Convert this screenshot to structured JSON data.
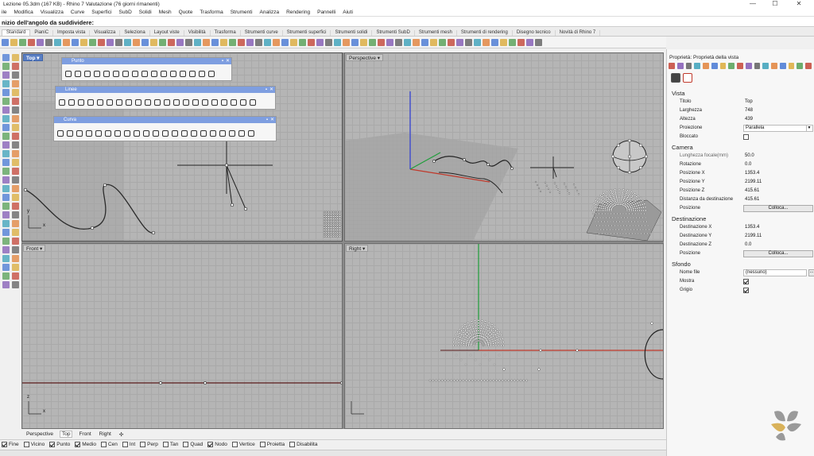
{
  "window": {
    "title": "Lezione 05.3dm (167 KB) - Rhino 7 Valutazione (76 giorni rimanenti)",
    "min": "—",
    "max": "☐",
    "close": "✕"
  },
  "menu": [
    "ile",
    "Modifica",
    "Visualizza",
    "Curve",
    "Superfici",
    "SubD",
    "Solidi",
    "Mesh",
    "Quote",
    "Trasforma",
    "Strumenti",
    "Analizza",
    "Rendering",
    "Pannelli",
    "Aiuti"
  ],
  "command_prompt": "nizio dell'angolo da suddividere:",
  "toolbar_tabs": [
    "Standard",
    "PianiC",
    "Imposta vista",
    "Visualizza",
    "Seleziona",
    "Layout viste",
    "Visibilità",
    "Trasforma",
    "Strumenti curve",
    "Strumenti superfici",
    "Strumenti solidi",
    "Strumenti SubD",
    "Strumenti mesh",
    "Strumenti di rendering",
    "Disegno tecnico",
    "Novità di Rhino 7"
  ],
  "viewports": {
    "top": "Top",
    "perspective": "Perspective",
    "front": "Front",
    "right": "Right",
    "menu_arrow": "▾",
    "axis_x": "x",
    "axis_y": "y",
    "axis_z": "z"
  },
  "floating_toolbars": {
    "punto": "Punto",
    "linee": "Linee",
    "curva": "Curva",
    "pin": "▪",
    "close": "✕"
  },
  "viewport_tabs": [
    "Perspective",
    "Top",
    "Front",
    "Right",
    "✣"
  ],
  "osnaps": [
    {
      "label": "Fine",
      "checked": true
    },
    {
      "label": "Vicino",
      "checked": false
    },
    {
      "label": "Punto",
      "checked": true
    },
    {
      "label": "Medio",
      "checked": true
    },
    {
      "label": "Cen",
      "checked": false
    },
    {
      "label": "Int",
      "checked": false
    },
    {
      "label": "Perp",
      "checked": false
    },
    {
      "label": "Tan",
      "checked": false
    },
    {
      "label": "Quad",
      "checked": false
    },
    {
      "label": "Nodo",
      "checked": true
    },
    {
      "label": "Vertice",
      "checked": false
    },
    {
      "label": "Proietta",
      "checked": false
    },
    {
      "label": "Disabilita",
      "checked": false
    }
  ],
  "properties": {
    "title": "Proprietà: Proprietà della vista",
    "sections": {
      "vista": "Vista",
      "camera": "Camera",
      "destinazione": "Destinazione",
      "sfondo": "Sfondo"
    },
    "vista": {
      "titolo_label": "Titolo",
      "titolo": "Top",
      "larghezza_label": "Larghezza",
      "larghezza": "748",
      "altezza_label": "Altezza",
      "altezza": "439",
      "proiezione_label": "Proiezione",
      "proiezione": "Parallela",
      "bloccato_label": "Bloccato",
      "bloccato": false
    },
    "camera": {
      "focale_label": "Lunghezza focale(mm)",
      "focale": "50.0",
      "rotazione_label": "Rotazione",
      "rotazione": "0.0",
      "posx_label": "Posizione X",
      "posx": "1353.4",
      "posy_label": "Posizione Y",
      "posy": "2199.11",
      "posz_label": "Posizione Z",
      "posz": "415.61",
      "dist_label": "Distanza da destinazione",
      "dist": "415.61",
      "posizione_label": "Posizione",
      "colloca": "Colloca..."
    },
    "destinazione": {
      "dx_label": "Destinazione X",
      "dx": "1353.4",
      "dy_label": "Destinazione Y",
      "dy": "2199.11",
      "dz_label": "Destinazione Z",
      "dz": "0.0",
      "posizione_label": "Posizione",
      "colloca": "Colloca..."
    },
    "sfondo": {
      "nome_label": "Nome file",
      "nome": "(nessuno)",
      "dots": "...",
      "mostra_label": "Mostra",
      "mostra": true,
      "grigio_label": "Grigio",
      "grigio": true
    }
  },
  "colors": {
    "active_viewport": "#5a7fc4",
    "x_axis": "#c0392b",
    "y_axis": "#1e9e3a",
    "z_axis": "#2b3bd6",
    "logo_gold": "#d9b25a",
    "logo_gray": "#9a9a9a"
  }
}
